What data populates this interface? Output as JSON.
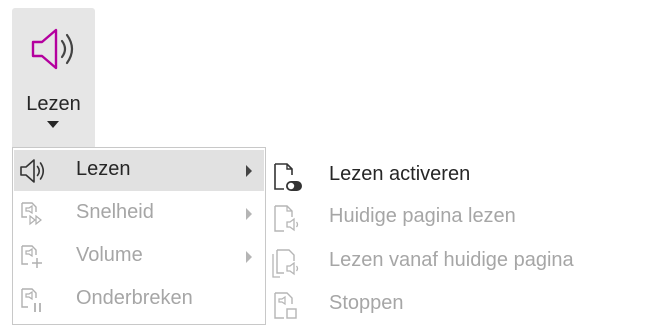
{
  "ribbon": {
    "read_button": {
      "label": "Lezen",
      "icon": "speaker-icon",
      "accent": "#b4009e"
    }
  },
  "menu": {
    "items": [
      {
        "label": "Lezen",
        "icon": "speaker-icon",
        "has_submenu": true,
        "enabled": true,
        "highlighted": true
      },
      {
        "label": "Snelheid",
        "icon": "speed-icon",
        "has_submenu": true,
        "enabled": false
      },
      {
        "label": "Volume",
        "icon": "volume-icon",
        "has_submenu": true,
        "enabled": false
      },
      {
        "label": "Onderbreken",
        "icon": "pause-icon",
        "has_submenu": false,
        "enabled": false
      }
    ]
  },
  "submenu": {
    "items": [
      {
        "label": "Lezen activeren",
        "icon": "activate-reading-icon",
        "enabled": true
      },
      {
        "label": "Huidige pagina lezen",
        "icon": "read-page-icon",
        "enabled": false
      },
      {
        "label": "Lezen vanaf huidige pagina",
        "icon": "read-from-page-icon",
        "enabled": false
      },
      {
        "label": "Stoppen",
        "icon": "stop-icon",
        "enabled": false
      }
    ]
  }
}
